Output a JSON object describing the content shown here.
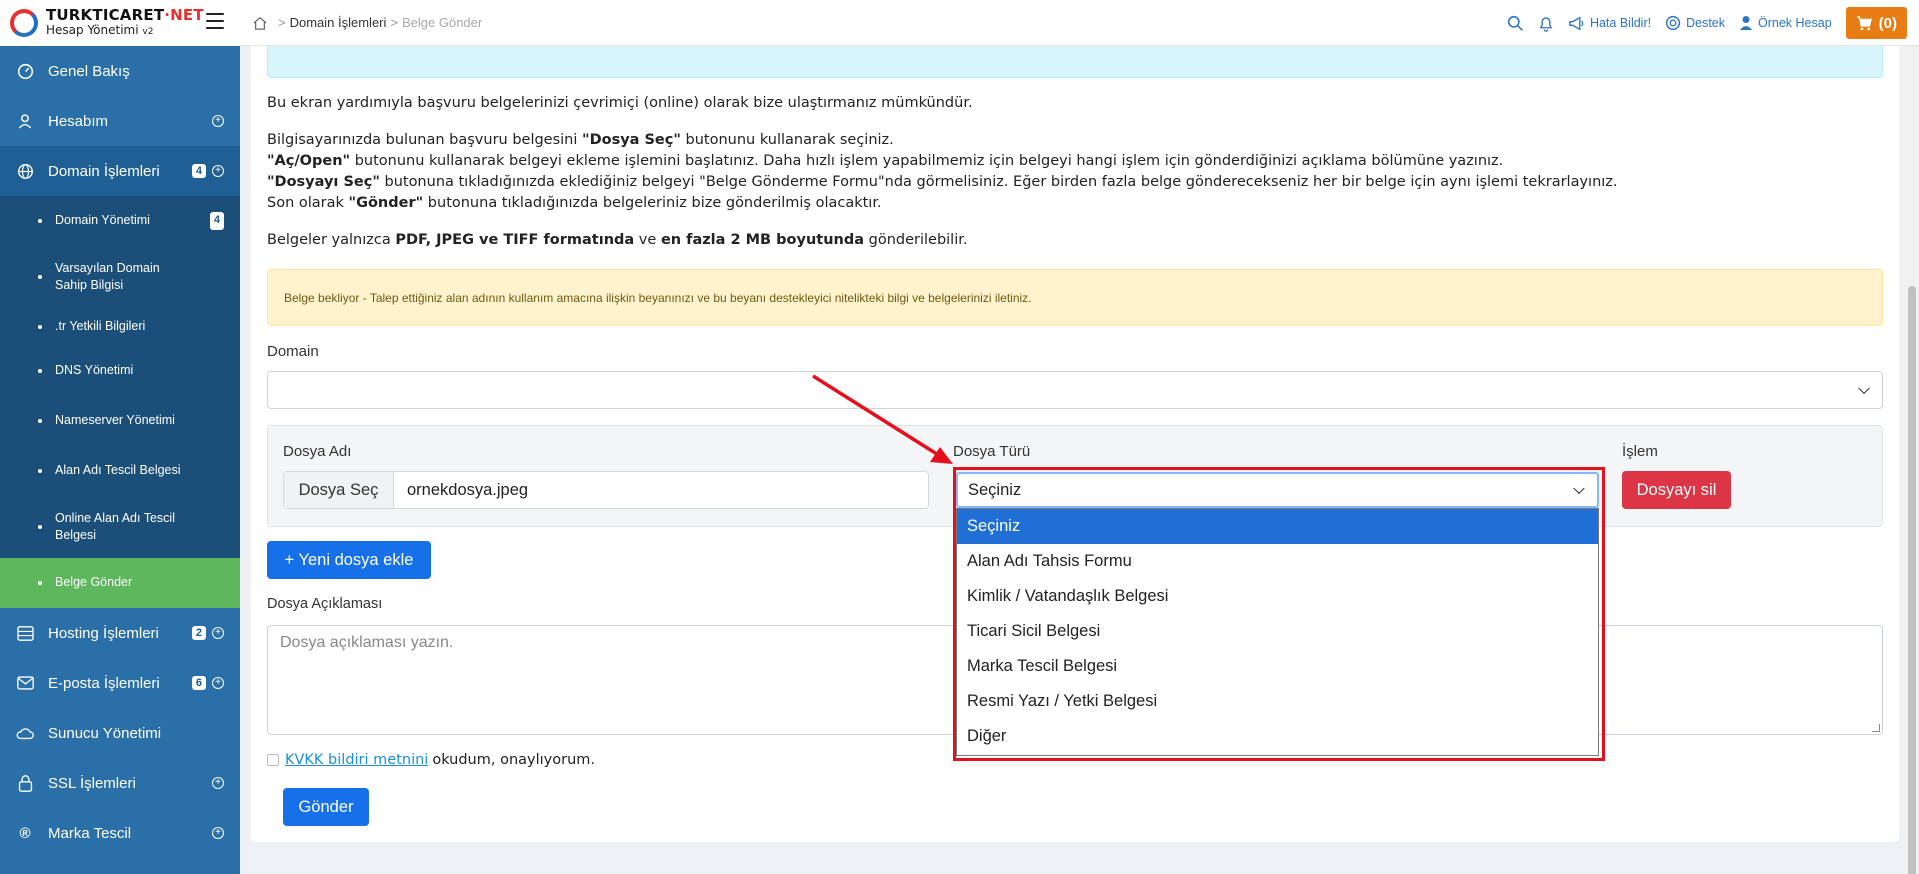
{
  "brand": {
    "title_a": "TURKTICARET",
    "title_b": "NET",
    "subtitle": "Hesap Yönetimi",
    "version": "v2"
  },
  "breadcrumb": {
    "item1": "Domain İşlemleri",
    "item2": "Belge Gönder"
  },
  "topbar": {
    "report": "Hata Bildir!",
    "support": "Destek",
    "account": "Örnek Hesap",
    "cart": "(0)"
  },
  "sidebar": {
    "items": [
      {
        "label": "Genel Bakış"
      },
      {
        "label": "Hesabım"
      },
      {
        "label": "Domain İşlemleri",
        "badge": "4"
      },
      {
        "label": "Hosting İşlemleri",
        "badge": "2"
      },
      {
        "label": "E-posta İşlemleri",
        "badge": "6"
      },
      {
        "label": "Sunucu Yönetimi"
      },
      {
        "label": "SSL İşlemleri"
      },
      {
        "label": "Marka Tescil"
      }
    ],
    "sub": [
      {
        "label": "Domain Yönetimi",
        "badge": "4"
      },
      {
        "label": "Varsayılan Domain Sahip Bilgisi"
      },
      {
        "label": ".tr Yetkili Bilgileri"
      },
      {
        "label": "DNS Yönetimi"
      },
      {
        "label": "Nameserver Yönetimi"
      },
      {
        "label": "Alan Adı Tescil Belgesi"
      },
      {
        "label": "Online Alan Adı Tescil Belgesi"
      },
      {
        "label": "Belge Gönder"
      }
    ]
  },
  "content": {
    "intro": "Bu ekran yardımıyla başvuru belgelerinizi çevrimiçi (online) olarak bize ulaştırmanız mümkündür.",
    "l1a": "Bilgisayarınızda bulunan başvuru belgesini ",
    "l1b": "\"Dosya Seç\"",
    "l1c": " butonunu kullanarak seçiniz.",
    "l2a": "\"Aç/Open\"",
    "l2b": " butonunu kullanarak belgeyi ekleme işlemini başlatınız. Daha hızlı işlem yapabilmemiz için belgeyi hangi işlem için gönderdiğinizi açıklama bölümüne yazınız.",
    "l3a": "\"Dosyayı Seç\"",
    "l3b": " butonuna tıkladığınızda eklediğiniz belgeyi \"Belge Gönderme Formu\"nda görmelisiniz. Eğer birden fazla belge gönderecekseniz her bir belge için aynı işlemi tekrarlayınız.",
    "l4a": "Son olarak ",
    "l4b": "\"Gönder\"",
    "l4c": " butonuna tıkladığınızda belgeleriniz bize gönderilmiş olacaktır.",
    "f1": "Belgeler yalnızca ",
    "f2": "PDF, JPEG ve TIFF formatında",
    "f3": " ve ",
    "f4": "en fazla 2 MB boyutunda",
    "f5": " gönderilebilir.",
    "warning": "Belge bekliyor - Talep ettiğiniz alan adının kullanım amacına ilişkin beyanınızı ve bu beyanı destekleyici nitelikteki bilgi ve belgelerinizi iletiniz."
  },
  "form": {
    "domain_label": "Domain",
    "file_name_label": "Dosya Adı",
    "file_type_label": "Dosya Türü",
    "action_label": "İşlem",
    "choose_file": "Dosya Seç",
    "file_name": "ornekdosya.jpeg",
    "select_value": "Seçiniz",
    "delete_file": "Dosyayı sil",
    "new_file": "+ Yeni dosya ekle",
    "desc_label": "Dosya Açıklaması",
    "desc_placeholder": "Dosya açıklaması yazın.",
    "kvkk_link": "KVKK bildiri metnini",
    "kvkk_text": "okudum, onaylıyorum.",
    "submit": "Gönder",
    "options": [
      "Seçiniz",
      "Alan Adı Tahsis Formu",
      "Kimlik / Vatandaşlık Belgesi",
      "Ticari Sicil Belgesi",
      "Marka Tescil Belgesi",
      "Resmi Yazı / Yetki Belgesi",
      "Diğer"
    ]
  },
  "colors": {
    "sidebar": "#2a6fa8",
    "active": "#5db75c",
    "primary": "#1670ea",
    "danger": "#dc3545",
    "highlight": "#e5101d"
  }
}
